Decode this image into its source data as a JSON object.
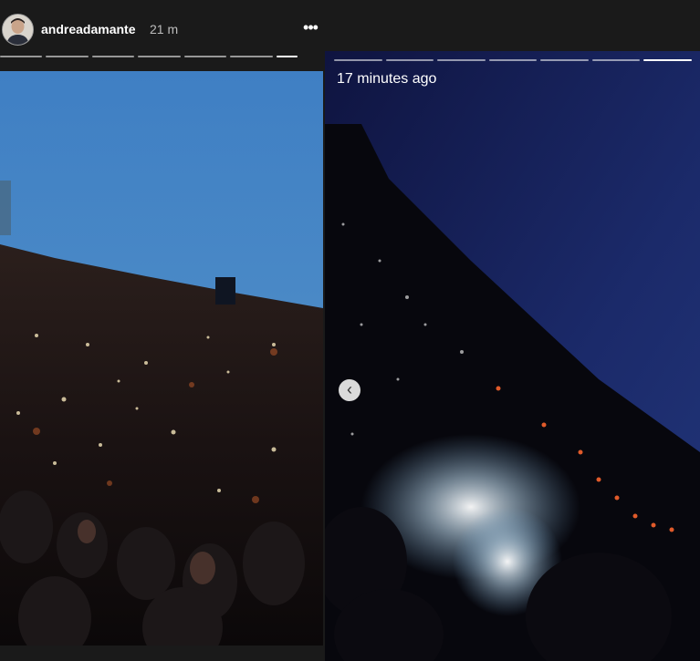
{
  "header": {
    "username": "andreadamante",
    "time": "21 m",
    "more_icon": "•••"
  },
  "story_left": {
    "segments": 7,
    "active_segment": 7
  },
  "story_right": {
    "time_ago": "17 minutes ago",
    "segments": 7,
    "active_segment": 7,
    "prev_icon": "‹"
  },
  "colors": {
    "background": "#1a1a1a",
    "text": "#ffffff",
    "muted": "#bdbdbd"
  }
}
